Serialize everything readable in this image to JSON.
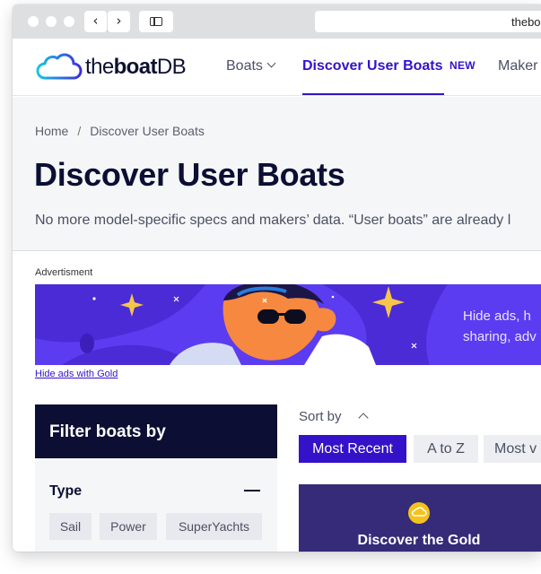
{
  "browser": {
    "url_fragment": "thebo",
    "back_glyph": "‹",
    "forward_glyph": "›"
  },
  "header": {
    "logo_prefix": "the",
    "logo_bold": "boat",
    "logo_suffix": "DB",
    "nav": [
      {
        "label": "Boats"
      },
      {
        "label": "Discover User Boats",
        "badge": "NEW"
      },
      {
        "label": "Maker"
      }
    ]
  },
  "hero": {
    "breadcrumb": [
      "Home",
      "Discover User Boats"
    ],
    "breadcrumb_sep": "/",
    "title": "Discover User Boats",
    "subtitle": "No more model-specific specs and makers’ data. “User boats” are already l"
  },
  "ad": {
    "label": "Advertisment",
    "line1": "Hide ads, h",
    "line2": "sharing, adv",
    "hide_link": "Hide ads with Gold"
  },
  "filter": {
    "title": "Filter boats by",
    "type_label": "Type",
    "chips": [
      "Sail",
      "Power",
      "SuperYachts"
    ]
  },
  "sort": {
    "label": "Sort by",
    "options": [
      "Most Recent",
      "A to Z",
      "Most v"
    ]
  },
  "gold_card": {
    "text": "Discover the Gold"
  },
  "colors": {
    "brand": "#3412c9",
    "navy": "#0c0f33",
    "ad_purple": "#5b3cf0",
    "gold": "#f4c21c"
  },
  "icons": [
    "back-arrow-icon",
    "forward-arrow-icon",
    "sidebar-toggle-icon",
    "cloud-logo-icon",
    "chevron-down-icon",
    "minus-icon",
    "chevron-up-icon",
    "gold-cloud-icon"
  ]
}
